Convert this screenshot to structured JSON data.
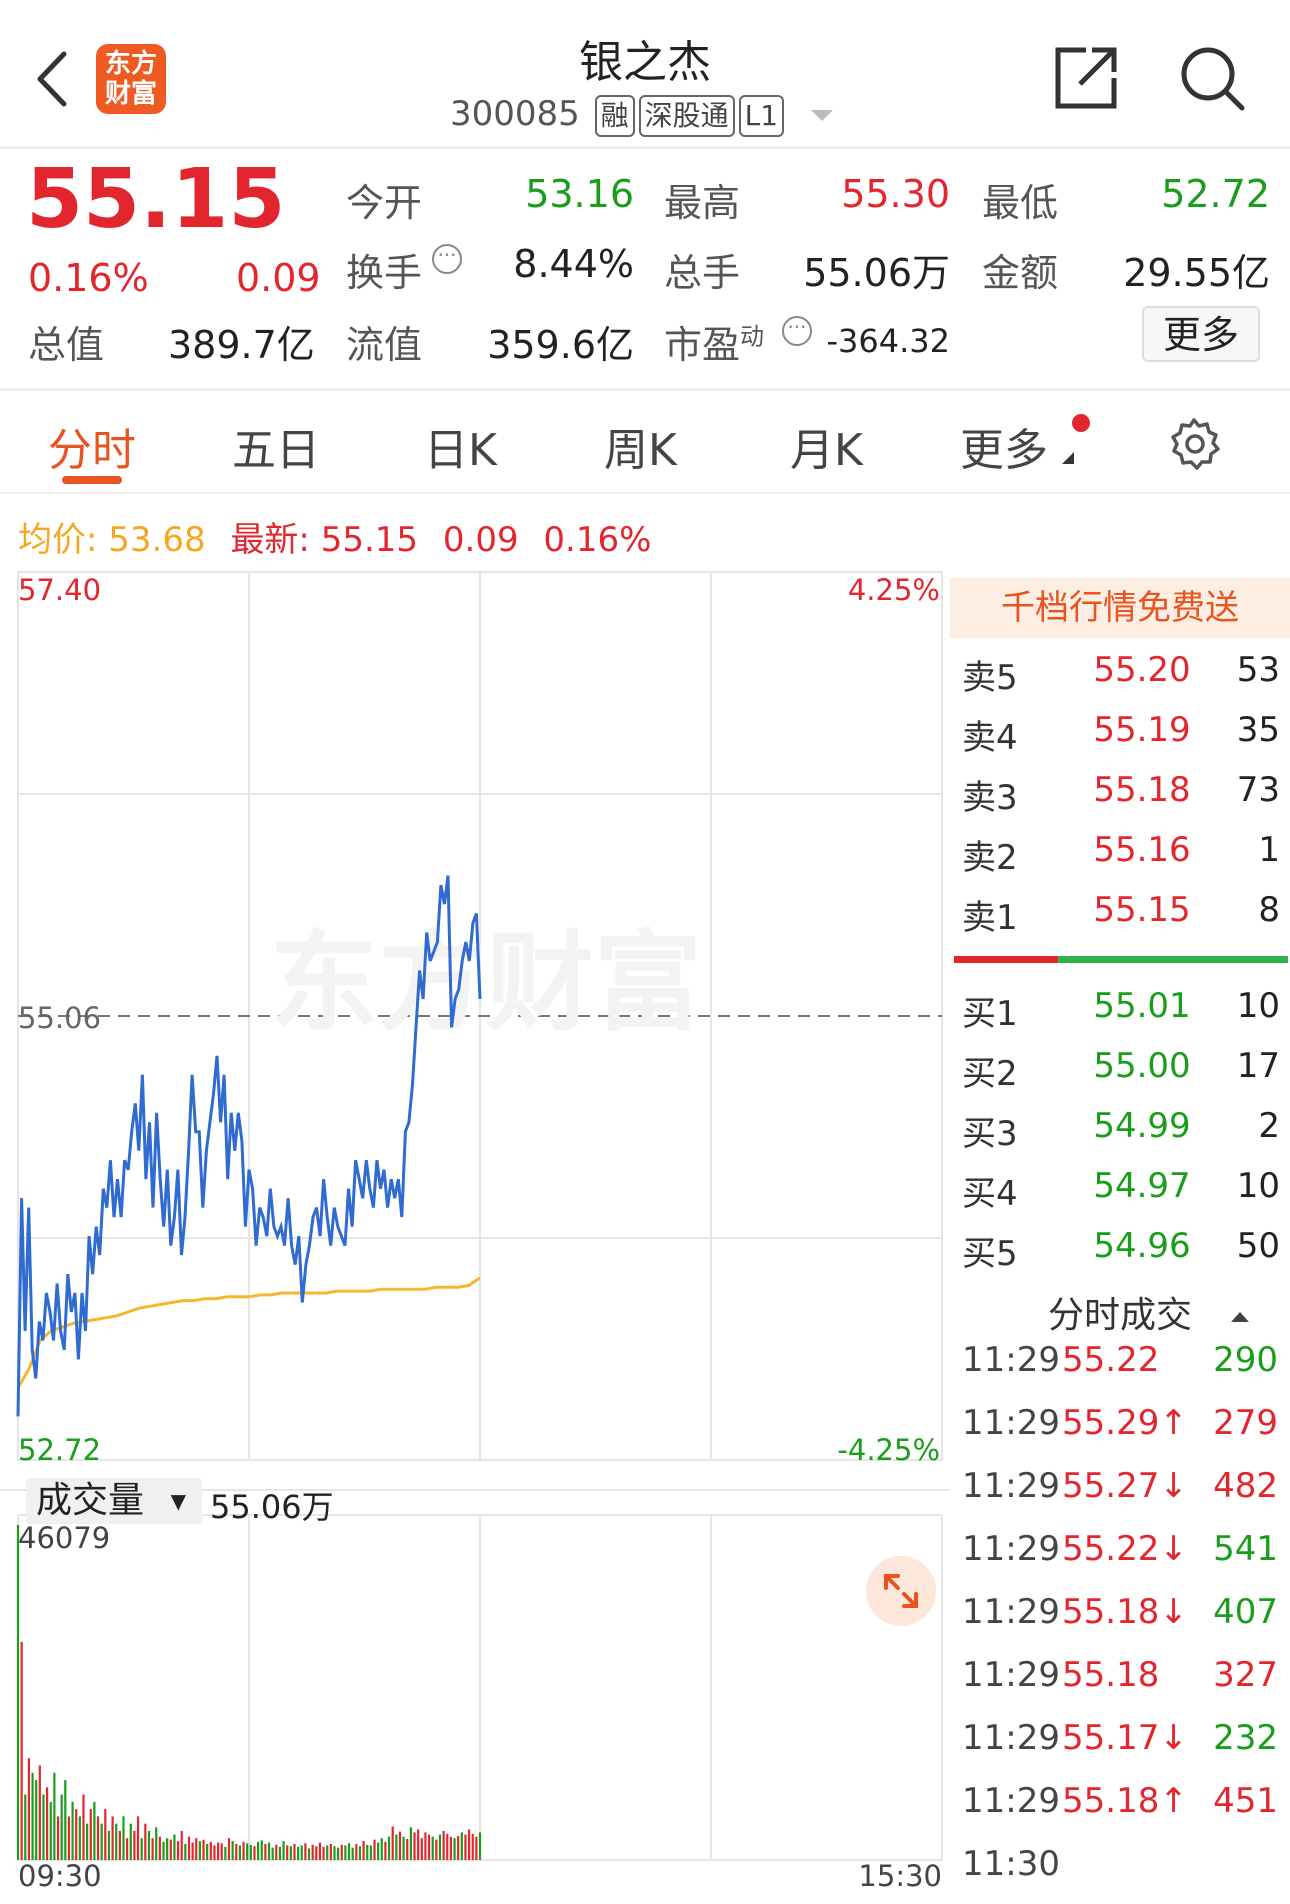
{
  "header": {
    "stock_name": "银之杰",
    "stock_code": "300085",
    "tags": [
      "融",
      "深股通",
      "L1"
    ],
    "logo_text": [
      "东方",
      "财富"
    ]
  },
  "quote": {
    "price": "55.15",
    "change_pct": "0.16%",
    "change": "0.09",
    "fields": {
      "open_label": "今开",
      "open": "53.16",
      "high_label": "最高",
      "high": "55.30",
      "low_label": "最低",
      "low": "52.72",
      "turnover_label": "换手",
      "turnover": "8.44%",
      "volume_label": "总手",
      "volume": "55.06万",
      "amount_label": "金额",
      "amount": "29.55亿",
      "mktcap_label": "总值",
      "mktcap": "389.7亿",
      "float_label": "流值",
      "float": "359.6亿",
      "pe_label": "市盈",
      "pe_sup": "动",
      "pe": "-364.32"
    },
    "more_button": "更多"
  },
  "tabs": [
    "分时",
    "五日",
    "日K",
    "周K",
    "月K",
    "更多"
  ],
  "active_tab": 0,
  "chart_info": {
    "avg_label": "均价:",
    "avg_value": "53.68",
    "latest_label": "最新:",
    "latest_value": "55.15",
    "latest_change": "0.09",
    "latest_pct": "0.16%"
  },
  "chart_data": {
    "type": "line",
    "price_axis": {
      "top": "57.40",
      "mid": "55.06",
      "bottom": "52.72",
      "ylim": [
        52.72,
        57.4
      ],
      "prev_close": 55.06
    },
    "pct_axis": {
      "top": "4.25%",
      "bottom": "-4.25%"
    },
    "watermark": "东方财富",
    "time_axis": {
      "start": "09:30",
      "end": "15:30"
    },
    "series": [
      {
        "values": [
          52.95,
          54.1,
          53.4,
          54.05,
          53.3,
          53.15,
          53.45,
          53.35,
          53.6,
          53.5,
          53.35,
          53.65,
          53.4,
          53.3,
          53.7,
          53.5,
          53.6,
          53.25,
          53.6,
          53.4,
          53.9,
          53.7,
          53.95,
          53.8,
          54.15,
          54.05,
          54.3,
          54.0,
          54.2,
          54.0,
          54.3,
          54.25,
          54.45,
          54.6,
          54.35,
          54.75,
          54.2,
          54.5,
          54.05,
          54.55,
          54.2,
          53.95,
          54.25,
          53.85,
          54.0,
          54.25,
          53.8,
          54.0,
          54.35,
          54.75,
          54.45,
          54.45,
          54.05,
          54.35,
          54.5,
          54.65,
          54.85,
          54.5,
          54.75,
          54.2,
          54.55,
          54.35,
          54.55,
          54.4,
          53.95,
          54.25,
          54.15,
          53.85,
          54.05,
          54.0,
          53.9,
          54.15,
          53.95,
          53.9,
          53.95,
          53.85,
          54.1,
          53.85,
          53.75,
          53.9,
          53.55,
          53.75,
          53.85,
          54.0,
          54.05,
          53.9,
          54.2,
          54.0,
          53.85,
          54.05,
          53.95,
          53.9,
          53.85,
          54.15,
          53.95,
          54.3,
          54.2,
          54.1,
          54.3,
          54.15,
          54.05,
          54.3,
          54.15,
          54.25,
          54.05,
          54.2,
          54.1,
          54.2,
          54.0,
          54.45,
          54.5,
          54.7,
          55.0,
          55.3,
          55.15,
          55.5,
          55.35,
          55.4,
          55.45,
          55.75,
          55.65,
          55.8,
          55.0,
          55.15,
          55.2,
          55.35,
          55.45,
          55.35,
          55.55,
          55.6,
          55.15
        ]
      },
      {
        "values": [
          53.1,
          53.2,
          53.35,
          53.4,
          53.42,
          53.44,
          53.45,
          53.46,
          53.47,
          53.48,
          53.5,
          53.52,
          53.53,
          53.54,
          53.55,
          53.56,
          53.56,
          53.57,
          53.57,
          53.58,
          53.58,
          53.58,
          53.59,
          53.59,
          53.6,
          53.6,
          53.6,
          53.6,
          53.6,
          53.61,
          53.61,
          53.61,
          53.61,
          53.62,
          53.62,
          53.62,
          53.62,
          53.62,
          53.63,
          53.63,
          53.63,
          53.64,
          53.68
        ]
      }
    ],
    "volume_label": "成交量",
    "volume_total": "55.06万",
    "volume_max": "46079",
    "volume": [
      46079,
      30000,
      9000,
      14000,
      12000,
      11000,
      13000,
      9000,
      10000,
      8000,
      12000,
      6000,
      9000,
      11000,
      6000,
      8000,
      7000,
      6000,
      9000,
      5000,
      7000,
      8000,
      6000,
      5000,
      7000,
      4000,
      6000,
      5000,
      4000,
      6000,
      3000,
      5000,
      4000,
      6000,
      3000,
      5000,
      4000,
      3000,
      4500,
      3200,
      2500,
      3000,
      2800,
      3500,
      2600,
      4000,
      2200,
      3200,
      2400,
      3000,
      2600,
      2800,
      2200,
      2500,
      2000,
      2400,
      2300,
      1800,
      3000,
      2600,
      2200,
      2000,
      2500,
      2300,
      2100,
      1900,
      2500,
      2700,
      2200,
      2400,
      1700,
      2100,
      1800,
      2600,
      2000,
      1900,
      2200,
      1800,
      2000,
      2300,
      1600,
      2100,
      1900,
      2400,
      1800,
      2000,
      2200,
      1900,
      1700,
      2100,
      2000,
      2300,
      1700,
      2200,
      1900,
      2600,
      2100,
      2000,
      2800,
      2400,
      3000,
      2500,
      3200,
      4600,
      3500,
      3900,
      3200,
      2900,
      4500,
      3800,
      4200,
      3000,
      3800,
      3500,
      3200,
      2800,
      3500,
      4000,
      3600,
      3200,
      3000,
      3300,
      3800,
      3500,
      4200,
      3600,
      3200,
      3800
    ]
  },
  "order_book": {
    "promo": "千档行情免费送",
    "asks": [
      {
        "name": "卖5",
        "price": "55.20",
        "vol": "53"
      },
      {
        "name": "卖4",
        "price": "55.19",
        "vol": "35"
      },
      {
        "name": "卖3",
        "price": "55.18",
        "vol": "73"
      },
      {
        "name": "卖2",
        "price": "55.16",
        "vol": "1"
      },
      {
        "name": "卖1",
        "price": "55.15",
        "vol": "8"
      }
    ],
    "bids": [
      {
        "name": "买1",
        "price": "55.01",
        "vol": "10"
      },
      {
        "name": "买2",
        "price": "55.00",
        "vol": "17"
      },
      {
        "name": "买3",
        "price": "54.99",
        "vol": "2"
      },
      {
        "name": "买4",
        "price": "54.97",
        "vol": "10"
      },
      {
        "name": "买5",
        "price": "54.96",
        "vol": "50"
      }
    ],
    "ask_ratio": 0.31
  },
  "trades": {
    "title": "分时成交",
    "rows": [
      {
        "time": "11:29",
        "price": "55.22",
        "vol": "290",
        "color": "#e3262d",
        "vcolor": "#1a9d1a"
      },
      {
        "time": "11:29",
        "price": "55.29↑",
        "vol": "279",
        "color": "#e3262d",
        "vcolor": "#e3262d"
      },
      {
        "time": "11:29",
        "price": "55.27↓",
        "vol": "482",
        "color": "#e3262d",
        "vcolor": "#e3262d"
      },
      {
        "time": "11:29",
        "price": "55.22↓",
        "vol": "541",
        "color": "#e3262d",
        "vcolor": "#1a9d1a"
      },
      {
        "time": "11:29",
        "price": "55.18↓",
        "vol": "407",
        "color": "#e3262d",
        "vcolor": "#1a9d1a"
      },
      {
        "time": "11:29",
        "price": "55.18",
        "vol": "327",
        "color": "#e3262d",
        "vcolor": "#e3262d"
      },
      {
        "time": "11:29",
        "price": "55.17↓",
        "vol": "232",
        "color": "#e3262d",
        "vcolor": "#1a9d1a"
      },
      {
        "time": "11:29",
        "price": "55.18↑",
        "vol": "451",
        "color": "#e3262d",
        "vcolor": "#e3262d"
      },
      {
        "time": "11:30",
        "price": "",
        "vol": "",
        "color": "#e3262d",
        "vcolor": "#1a9d1a"
      }
    ]
  },
  "colors": {
    "red": "#e3262d",
    "green": "#1a9d1a",
    "orange": "#e8531f",
    "avg_line": "#f5b731",
    "price_line": "#2f6bd1"
  }
}
